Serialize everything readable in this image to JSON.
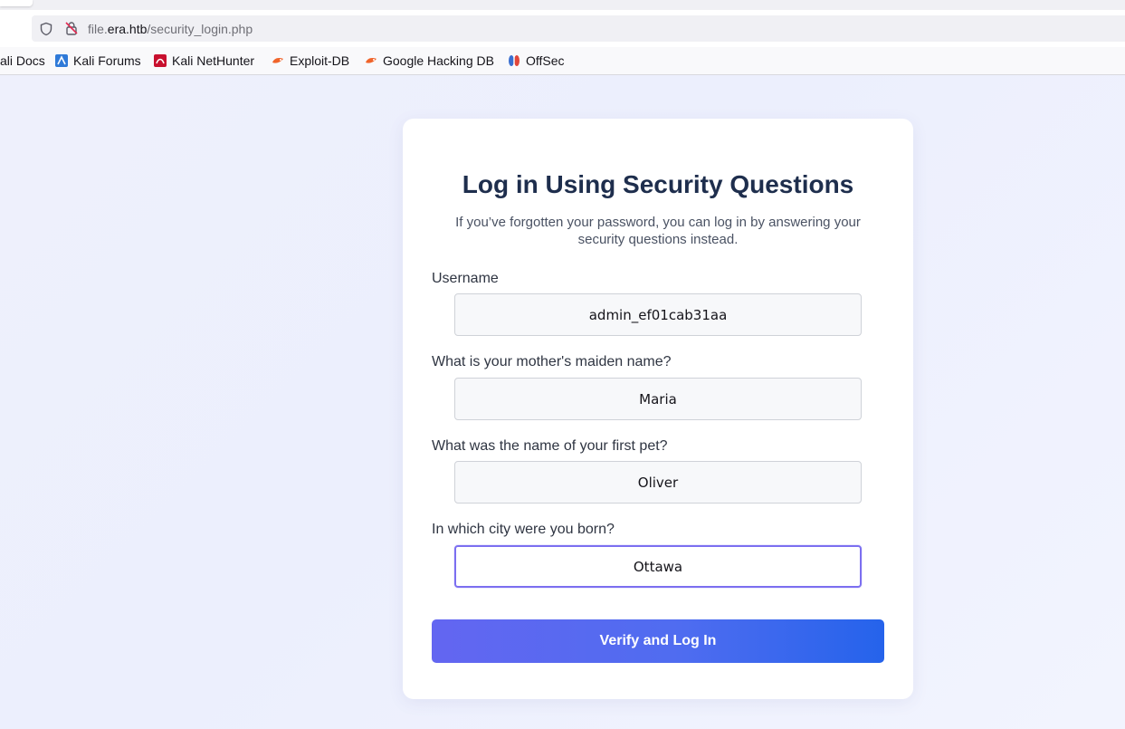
{
  "browser": {
    "url_scheme": "file.",
    "url_host": "era.htb",
    "url_path": "/security_login.php",
    "bookmarks": [
      {
        "label": "ali Docs",
        "icon": "kali-docs-icon"
      },
      {
        "label": "Kali Forums",
        "icon": "kali-forums-icon"
      },
      {
        "label": "Kali NetHunter",
        "icon": "kali-nethunter-icon"
      },
      {
        "label": "Exploit-DB",
        "icon": "exploit-db-icon"
      },
      {
        "label": "Google Hacking DB",
        "icon": "google-hacking-db-icon"
      },
      {
        "label": "OffSec",
        "icon": "offsec-icon"
      }
    ]
  },
  "form": {
    "title": "Log in Using Security Questions",
    "subtitle": "If you’ve forgotten your password, you can log in by answering your security questions instead.",
    "fields": [
      {
        "label": "Username",
        "value": "admin_ef01cab31aa"
      },
      {
        "label": "What is your mother's maiden name?",
        "value": "Maria"
      },
      {
        "label": "What was the name of your first pet?",
        "value": "Oliver"
      },
      {
        "label": "In which city were you born?",
        "value": "Ottawa"
      }
    ],
    "submit_label": "Verify and Log In"
  },
  "colors": {
    "accent_start": "#6366f1",
    "accent_end": "#2563eb",
    "title": "#1e2e4d",
    "focus_border": "#7c6ff0"
  }
}
